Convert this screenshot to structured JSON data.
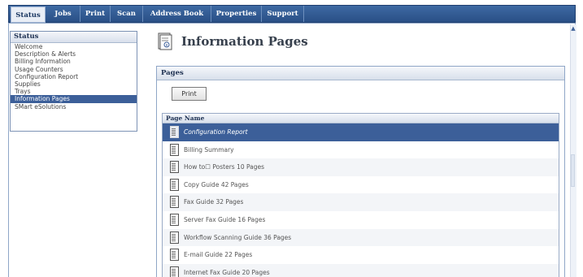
{
  "tabs": [
    {
      "label": "Status"
    },
    {
      "label": "Jobs"
    },
    {
      "label": "Print"
    },
    {
      "label": "Scan"
    },
    {
      "label": "Address Book"
    },
    {
      "label": "Properties"
    },
    {
      "label": "Support"
    }
  ],
  "sidebar": {
    "title": "Status",
    "items": [
      {
        "label": "Welcome"
      },
      {
        "label": "Description & Alerts"
      },
      {
        "label": "Billing Information"
      },
      {
        "label": "Usage Counters"
      },
      {
        "label": "Configuration Report"
      },
      {
        "label": "Supplies"
      },
      {
        "label": "Trays"
      },
      {
        "label": "Information Pages"
      },
      {
        "label": "SMart eSolutions"
      }
    ]
  },
  "page": {
    "title": "Information Pages",
    "icon": "information-page-icon"
  },
  "panel": {
    "header": "Pages",
    "print_label": "Print",
    "table": {
      "column": "Page Name",
      "rows": [
        {
          "label": "Configuration Report"
        },
        {
          "label": "Billing Summary"
        },
        {
          "label": "How to☐ Posters 10 Pages"
        },
        {
          "label": "Copy Guide 42 Pages"
        },
        {
          "label": "Fax Guide 32 Pages"
        },
        {
          "label": "Server Fax Guide 16 Pages"
        },
        {
          "label": "Workflow Scanning Guide 36 Pages"
        },
        {
          "label": "E-mail Guide 22 Pages"
        },
        {
          "label": "Internet Fax Guide 20 Pages"
        }
      ]
    }
  },
  "colors": {
    "tabbar": "#2a4f86",
    "selected": "#3c5f99"
  }
}
